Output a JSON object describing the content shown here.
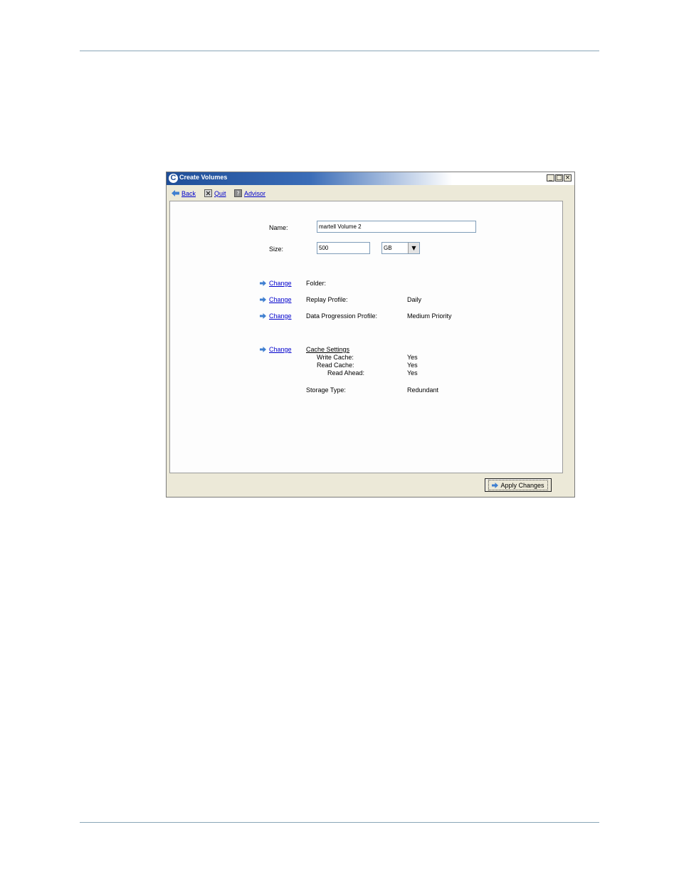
{
  "window": {
    "title": "Create Volumes"
  },
  "toolbar": {
    "back": "Back",
    "quit": "Quit",
    "advisor": "Advisor"
  },
  "form": {
    "name_label": "Name:",
    "name_value": "martell Volume 2",
    "size_label": "Size:",
    "size_value": "500",
    "size_unit": "GB"
  },
  "settings": {
    "change_label": "Change",
    "folder_label": "Folder:",
    "replay_label": "Replay Profile:",
    "replay_value": "Daily",
    "progression_label": "Data Progression Profile:",
    "progression_value": "Medium Priority",
    "cache_label": "Cache Settings",
    "write_cache_label": "Write Cache:",
    "write_cache_value": "Yes",
    "read_cache_label": "Read Cache:",
    "read_cache_value": "Yes",
    "read_ahead_label": "Read Ahead:",
    "read_ahead_value": "Yes",
    "storage_type_label": "Storage Type:",
    "storage_type_value": "Redundant"
  },
  "footer": {
    "apply_label": "Apply Changes"
  },
  "icons": {
    "back": "arrow-left-icon",
    "quit": "close-box-icon",
    "advisor": "help-icon",
    "change": "arrow-right-icon"
  },
  "colors": {
    "link": "#0000cc",
    "titlebar": "#1f4e98",
    "arrow": "#3f7fd0"
  }
}
